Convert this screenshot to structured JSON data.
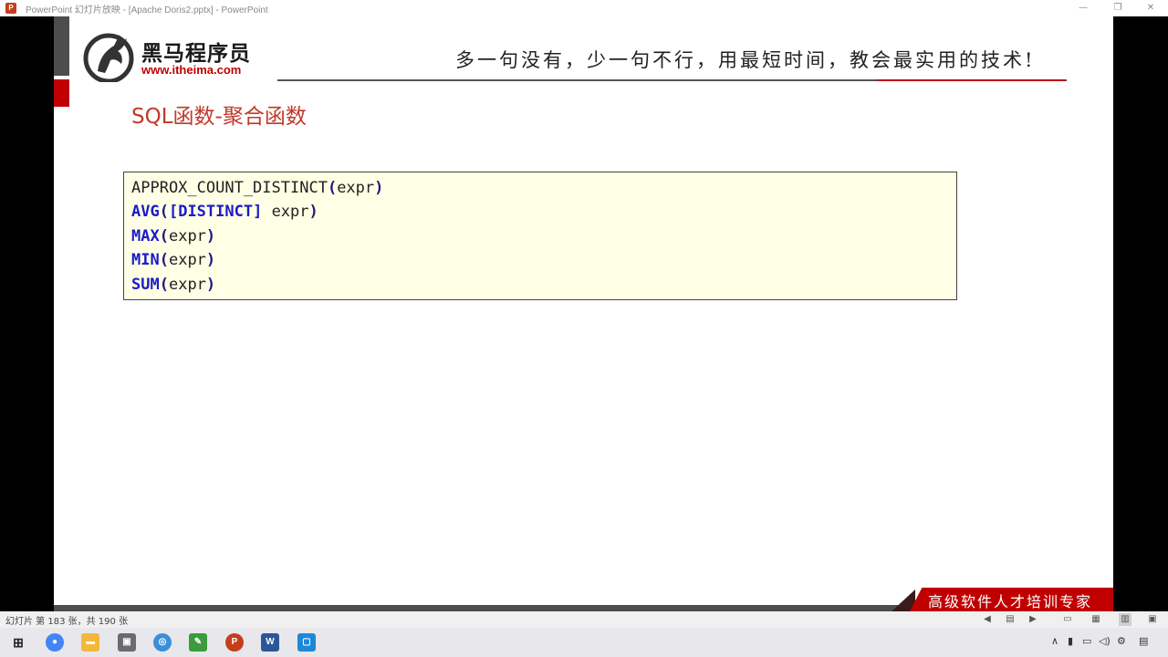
{
  "window": {
    "title": "PowerPoint 幻灯片放映 - [Apache Doris2.pptx] - PowerPoint",
    "minimize": "—",
    "restore": "❐",
    "close": "✕"
  },
  "slide": {
    "logo_cn": "黑马程序员",
    "logo_url": "www.itheima.com",
    "slogan": "多一句没有，少一句不行，用最短时间，教会最实用的技术!",
    "heading": "SQL函数-聚合函数",
    "code_lines": [
      {
        "fn": "APPROX_COUNT_DISTINCT",
        "open": "(",
        "arg": "expr",
        "close": ")"
      },
      {
        "fn": "AVG",
        "open": "(",
        "mid": "[DISTINCT]",
        "arg": " expr",
        "close": ")"
      },
      {
        "fn": "MAX",
        "open": "(",
        "arg": "expr",
        "close": ")"
      },
      {
        "fn": "MIN",
        "open": "(",
        "arg": "expr",
        "close": ")"
      },
      {
        "fn": "SUM",
        "open": "(",
        "arg": "expr",
        "close": ")"
      }
    ],
    "footer": "高级软件人才培训专家"
  },
  "statusbar": {
    "slide_count": "幻灯片 第 183 张，共 190 张"
  },
  "taskbar": {
    "icons": [
      "windows-start-icon",
      "chrome-icon",
      "file-explorer-icon",
      "app-icon",
      "browser-icon",
      "edit-icon",
      "powerpoint-icon",
      "word-icon",
      "remote-icon"
    ]
  },
  "colors": {
    "brand_red": "#c00000",
    "heading_red": "#c0392b",
    "keyword_blue": "#1a1acc",
    "code_bg": "#ffffe5"
  }
}
